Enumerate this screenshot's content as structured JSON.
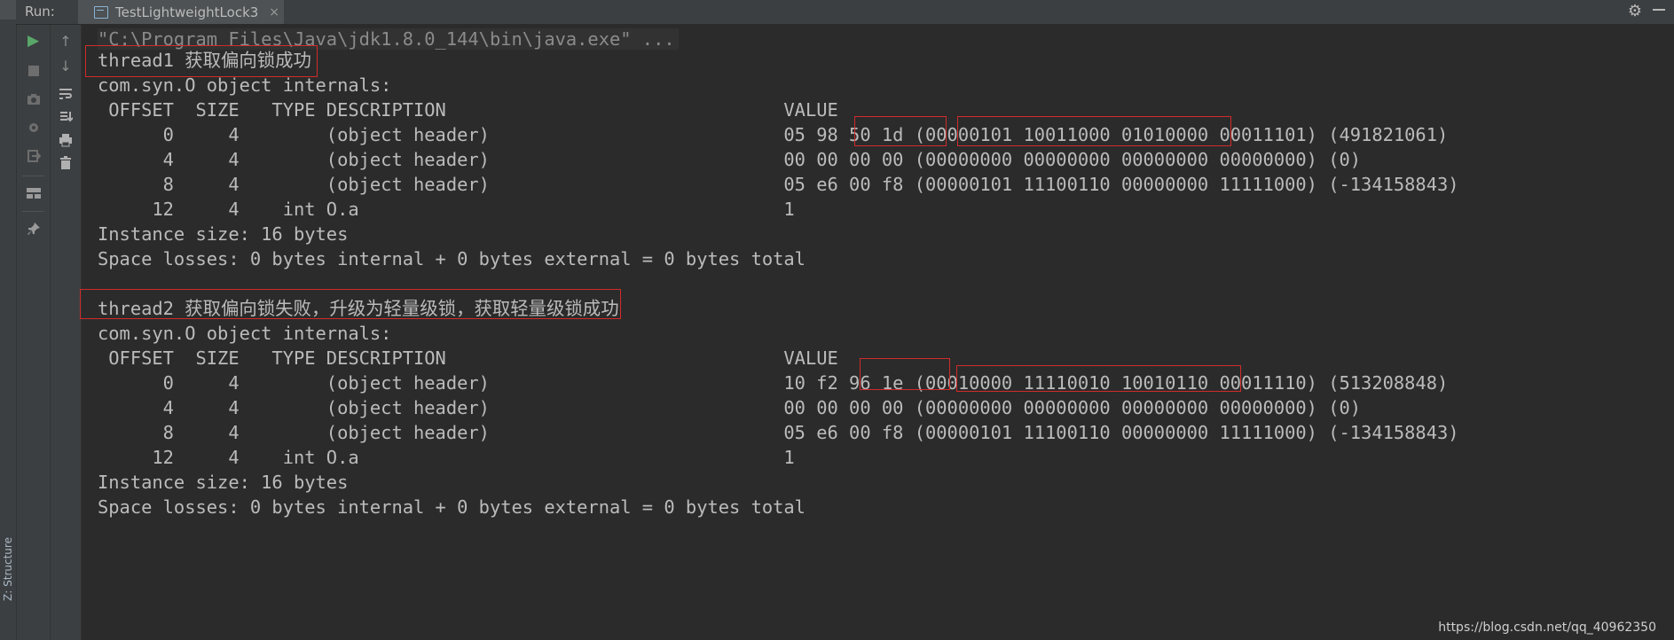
{
  "topbar": {
    "run_label": "Run:",
    "tab_title": "TestLightweightLock3",
    "tab_close": "×",
    "gear_icon": "⚙"
  },
  "side_panel": {
    "structure_label": "Z: Structure"
  },
  "toolbar": {
    "run": "▶",
    "up": "↑",
    "down": "↓"
  },
  "console": {
    "lines": [
      "\"C:\\Program Files\\Java\\jdk1.8.0_144\\bin\\java.exe\" ...",
      "thread1 获取偏向锁成功",
      "com.syn.O object internals:",
      " OFFSET  SIZE   TYPE DESCRIPTION                               VALUE",
      "      0     4        (object header)                           05 98 50 1d (00000101 10011000 01010000 00011101) (491821061)",
      "      4     4        (object header)                           00 00 00 00 (00000000 00000000 00000000 00000000) (0)",
      "      8     4        (object header)                           05 e6 00 f8 (00000101 11100110 00000000 11111000) (-134158843)",
      "     12     4    int O.a                                       1",
      "Instance size: 16 bytes",
      "Space losses: 0 bytes internal + 0 bytes external = 0 bytes total",
      "thread2 获取偏向锁失败，升级为轻量级锁，获取轻量级锁成功",
      "com.syn.O object internals:",
      " OFFSET  SIZE   TYPE DESCRIPTION                               VALUE",
      "      0     4        (object header)                           10 f2 96 1e (00010000 11110010 10010110 00011110) (513208848)",
      "      4     4        (object header)                           00 00 00 00 (00000000 00000000 00000000 00000000) (0)",
      "      8     4        (object header)                           05 e6 00 f8 (00000101 11100110 00000000 11111000) (-134158843)",
      "     12     4    int O.a                                       1",
      "Instance size: 16 bytes",
      "Space losses: 0 bytes internal + 0 bytes external = 0 bytes total"
    ]
  },
  "watermark": "https://blog.csdn.net/qq_40962350",
  "colors": {
    "highlight_box": "#d02b2b",
    "background": "#2b2b2b",
    "text": "#bbbbbb"
  }
}
